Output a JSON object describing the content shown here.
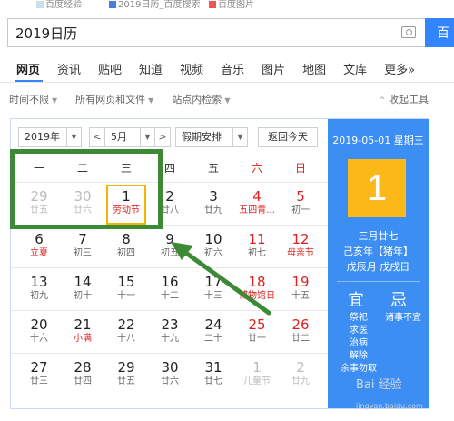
{
  "browser_tabs": [
    "百度经验",
    "2019日历_百度搜索",
    "百度图片"
  ],
  "search": {
    "query": "2019日历",
    "button_label": "百"
  },
  "nav_tabs": [
    "网页",
    "资讯",
    "贴吧",
    "知道",
    "视频",
    "音乐",
    "图片",
    "地图",
    "文库",
    "更多»"
  ],
  "filters": {
    "time": "时间不限",
    "type": "所有网页和文件",
    "site": "站点内检索",
    "collapse": "收起工具"
  },
  "calendar": {
    "year_select": "2019年",
    "month_select": "5月",
    "prev_label": "<",
    "next_label": ">",
    "holiday_select": "假期安排",
    "today_button": "返回今天",
    "weekdays": [
      "一",
      "二",
      "三",
      "四",
      "五",
      "六",
      "日"
    ],
    "weeks": [
      [
        {
          "n": "29",
          "l": "廿五",
          "dim": true
        },
        {
          "n": "30",
          "l": "廿六",
          "dim": true
        },
        {
          "n": "1",
          "l": "劳动节",
          "festival": true,
          "selected": true
        },
        {
          "n": "2",
          "l": "廿八"
        },
        {
          "n": "3",
          "l": "廿九"
        },
        {
          "n": "4",
          "l": "五四青...",
          "weekend": true,
          "festival": true
        },
        {
          "n": "5",
          "l": "初一",
          "weekend": true
        }
      ],
      [
        {
          "n": "6",
          "l": "立夏",
          "festival": true
        },
        {
          "n": "7",
          "l": "初三"
        },
        {
          "n": "8",
          "l": "初四"
        },
        {
          "n": "9",
          "l": "初五"
        },
        {
          "n": "10",
          "l": "初六"
        },
        {
          "n": "11",
          "l": "初七",
          "weekend": true
        },
        {
          "n": "12",
          "l": "母亲节",
          "weekend": true,
          "festival": true
        }
      ],
      [
        {
          "n": "13",
          "l": "初九"
        },
        {
          "n": "14",
          "l": "初十"
        },
        {
          "n": "15",
          "l": "十一"
        },
        {
          "n": "16",
          "l": "十二"
        },
        {
          "n": "17",
          "l": "十三"
        },
        {
          "n": "18",
          "l": "博物馆日",
          "weekend": true,
          "festival": true
        },
        {
          "n": "19",
          "l": "十五",
          "weekend": true
        }
      ],
      [
        {
          "n": "20",
          "l": "十六"
        },
        {
          "n": "21",
          "l": "小满",
          "festival": true
        },
        {
          "n": "22",
          "l": "十八"
        },
        {
          "n": "23",
          "l": "十九"
        },
        {
          "n": "24",
          "l": "二十"
        },
        {
          "n": "25",
          "l": "廿一",
          "weekend": true
        },
        {
          "n": "26",
          "l": "廿二",
          "weekend": true
        }
      ],
      [
        {
          "n": "27",
          "l": "廿三"
        },
        {
          "n": "28",
          "l": "廿四"
        },
        {
          "n": "29",
          "l": "廿五"
        },
        {
          "n": "30",
          "l": "廿六"
        },
        {
          "n": "31",
          "l": "廿七"
        },
        {
          "n": "1",
          "l": "儿童节",
          "dim": true
        },
        {
          "n": "2",
          "l": "廿九",
          "dim": true
        }
      ]
    ],
    "side": {
      "date_line": "2019-05-01 星期三",
      "big_day": "1",
      "lunar": "三月廿七",
      "ganzhi_year": "己亥年【猪年】",
      "ganzhi_month_day": "戊辰月 戊戌日",
      "yi_label": "宜",
      "ji_label": "忌",
      "yi_items": [
        "祭祀",
        "求医",
        "治病",
        "解除",
        "余事勿取"
      ],
      "ji_items": [
        "诸事不宜"
      ]
    }
  },
  "watermark": {
    "main": "Bai 经验",
    "sub": "jingyan.baidu.com"
  },
  "colors": {
    "accent": "#3385ff",
    "side_panel": "#3d8ef3",
    "big_day_bg": "#fbb817",
    "holiday_red": "#e02020",
    "annotation_green": "#3d8a36"
  }
}
